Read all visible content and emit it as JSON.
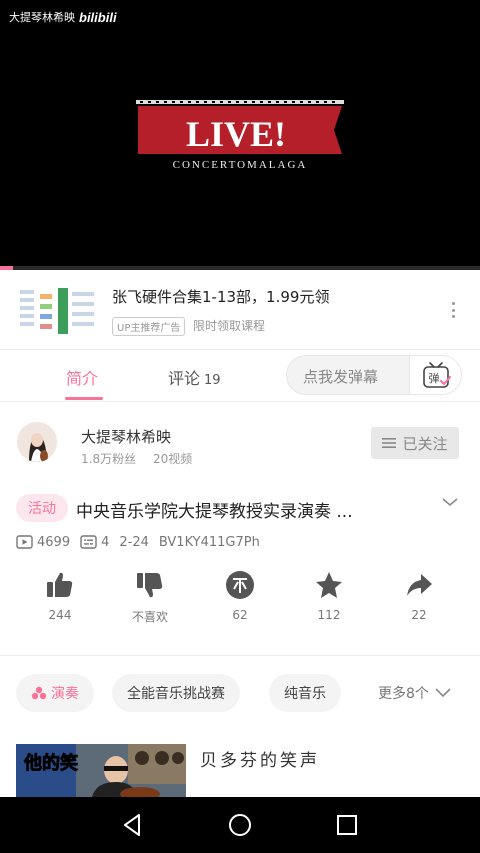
{
  "player": {
    "watermark_channel": "大提琴林希映",
    "watermark_brand": "bilibili",
    "logo_text": "LIVE!",
    "logo_subtext": "CONCERTOMALAGA",
    "progress_fraction": 0.027
  },
  "ad": {
    "title": "张飞硬件合集1-13部，1.99元领",
    "badge": "UP主推荐广告",
    "subtitle": "限时领取课程"
  },
  "tabs": {
    "intro_label": "简介",
    "comments_label": "评论",
    "comments_count": "19",
    "danmaku_placeholder": "点我发弹幕",
    "danmaku_icon_char": "弹"
  },
  "uploader": {
    "name": "大提琴林希映",
    "fans": "1.8万粉丝",
    "videos": "20视频",
    "follow_label": "已关注"
  },
  "video": {
    "activity_badge": "活动",
    "title": "中央音乐学院大提琴教授实录演奏 ...",
    "views": "4699",
    "danmaku_count": "4",
    "date": "2-24",
    "bvid": "BV1KY411G7Ph"
  },
  "actions": {
    "like": "244",
    "dislike": "不喜欢",
    "coin": "62",
    "favorite": "112",
    "share": "22"
  },
  "tags": {
    "items": [
      "演奏",
      "全能音乐挑战赛",
      "纯音乐"
    ],
    "more_label": "更多8个"
  },
  "related": {
    "thumb_text": "他的笑",
    "title": "贝多芬的笑声"
  },
  "colors": {
    "accent": "#fb7299",
    "logo_red": "#b51f2a"
  }
}
